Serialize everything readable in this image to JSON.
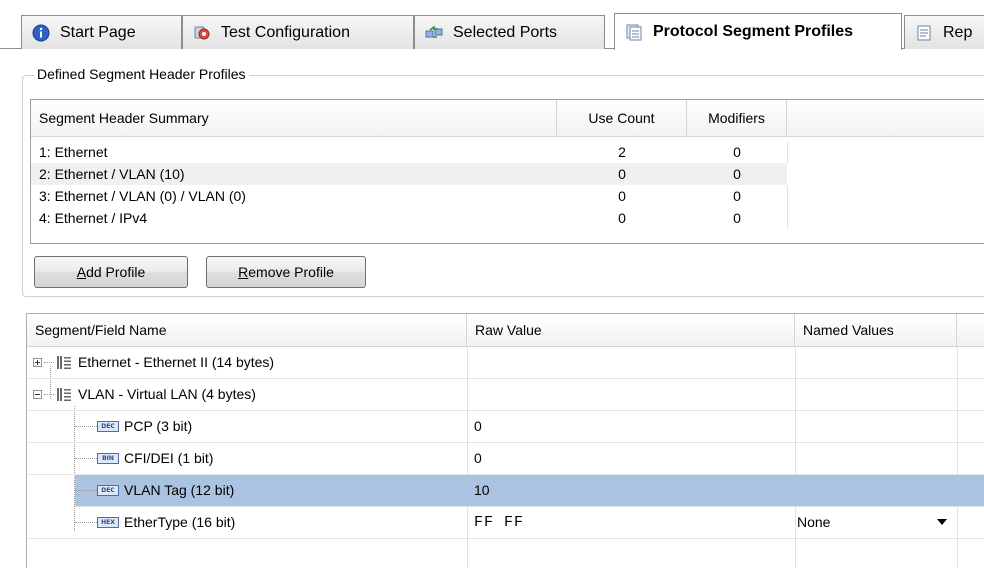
{
  "tabs": [
    {
      "label": "Start Page",
      "icon": "info-icon",
      "active": false
    },
    {
      "label": "Test Configuration",
      "icon": "test-config-icon",
      "active": false
    },
    {
      "label": "Selected Ports",
      "icon": "ports-icon",
      "active": false
    },
    {
      "label": "Protocol Segment Profiles",
      "icon": "profiles-icon",
      "active": true
    },
    {
      "label": "Rep",
      "icon": "report-icon",
      "active": false
    }
  ],
  "profiles_group": {
    "title": "Defined Segment Header Profiles",
    "columns": [
      "Segment Header Summary",
      "Use Count",
      "Modifiers"
    ],
    "rows": [
      {
        "summary": "1: Ethernet",
        "use_count": "2",
        "modifiers": "0"
      },
      {
        "summary": "2: Ethernet / VLAN (10)",
        "use_count": "0",
        "modifiers": "0"
      },
      {
        "summary": "3: Ethernet / VLAN (0) / VLAN (0)",
        "use_count": "0",
        "modifiers": "0"
      },
      {
        "summary": "4: Ethernet / IPv4",
        "use_count": "0",
        "modifiers": "0"
      }
    ],
    "add_button": {
      "prefix": "",
      "accel": "A",
      "suffix": "dd Profile"
    },
    "remove_button": {
      "prefix": "",
      "accel": "R",
      "suffix": "emove Profile"
    }
  },
  "field_grid": {
    "columns": [
      "Segment/Field Name",
      "Raw Value",
      "Named Values"
    ],
    "rows": [
      {
        "name": "Ethernet - Ethernet II (14 bytes)",
        "raw": "",
        "named": "",
        "kind": "segment",
        "expanded": false
      },
      {
        "name": "VLAN - Virtual LAN (4 bytes)",
        "raw": "",
        "named": "",
        "kind": "segment",
        "expanded": true
      },
      {
        "name": "PCP (3 bit)",
        "raw": "0",
        "named": "",
        "kind": "field",
        "badge": "DEC"
      },
      {
        "name": "CFI/DEI (1 bit)",
        "raw": "0",
        "named": "",
        "kind": "field",
        "badge": "BIN"
      },
      {
        "name": "VLAN Tag (12 bit)",
        "raw": "10",
        "named": "",
        "kind": "field",
        "badge": "DEC",
        "selected": true
      },
      {
        "name": "EtherType (16 bit)",
        "raw": "FF FF",
        "named": "None",
        "kind": "field",
        "badge": "HEX"
      }
    ]
  },
  "colors": {
    "selection": "#a9c3e0",
    "alt_row": "#f0f0f0",
    "border": "#8c8c8c"
  }
}
